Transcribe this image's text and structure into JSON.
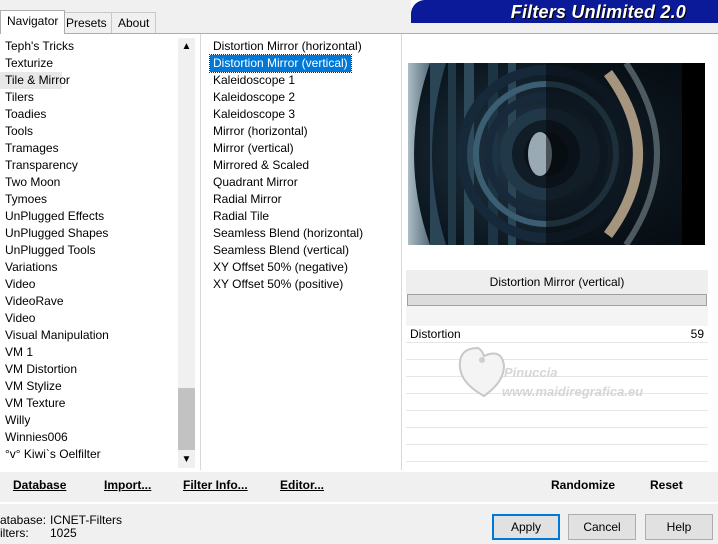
{
  "tabs": [
    {
      "label": "Navigator"
    },
    {
      "label": "Presets"
    },
    {
      "label": "About"
    }
  ],
  "app_title": "Filters Unlimited 2.0",
  "categories": [
    "Teph's Tricks",
    "Texturize",
    "Tile & Mirror",
    "Tilers",
    "Toadies",
    "Tools",
    "Tramages",
    "Transparency",
    "Two Moon",
    "Tymoes",
    "UnPlugged Effects",
    "UnPlugged Shapes",
    "UnPlugged Tools",
    "Variations",
    "Video",
    "VideoRave",
    "Video",
    "Visual Manipulation",
    "VM 1",
    "VM Distortion",
    "VM Stylize",
    "VM Texture",
    "Willy",
    "Winnies006",
    "°v° Kiwi`s Oelfilter"
  ],
  "filters": [
    "Distortion Mirror (horizontal)",
    "Distortion Mirror (vertical)",
    "Kaleidoscope 1",
    "Kaleidoscope 2",
    "Kaleidoscope 3",
    "Mirror (horizontal)",
    "Mirror (vertical)",
    "Mirrored & Scaled",
    "Quadrant Mirror",
    "Radial Mirror",
    "Radial Tile",
    "Seamless Blend (horizontal)",
    "Seamless Blend (vertical)",
    "XY Offset 50% (negative)",
    "XY Offset 50% (positive)"
  ],
  "selected_filter_name": "Distortion Mirror (vertical)",
  "parameter": {
    "label": "Distortion",
    "value": "59"
  },
  "watermark": {
    "line1": "Pinuccia",
    "line2": "www.maidiregrafica.eu"
  },
  "bottom_buttons": {
    "database": "Database",
    "import": "Import...",
    "filter_info": "Filter Info...",
    "editor": "Editor...",
    "randomize": "Randomize",
    "reset": "Reset"
  },
  "status": {
    "database_label": "atabase:",
    "database_value": "ICNET-Filters",
    "filters_label": "ilters:",
    "filters_value": "1025"
  },
  "dialog_buttons": {
    "apply": "Apply",
    "cancel": "Cancel",
    "help": "Help"
  },
  "colors": {
    "accent": "#0078d7",
    "banner": "#0b1a99"
  }
}
